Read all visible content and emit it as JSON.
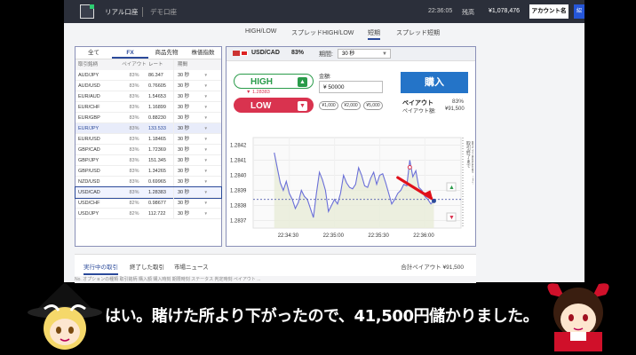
{
  "topbar": {
    "tab_real": "リアル口座",
    "tab_demo": "デモ口座",
    "time": "22:36:05",
    "balance_label": "残高",
    "balance": "¥1,078,476",
    "account_button": "アカウント名",
    "corner_label": "紹"
  },
  "modes": [
    "HIGH/LOW",
    "スプレッドHIGH/LOW",
    "短期",
    "スプレッド短期"
  ],
  "active_mode": "短期",
  "left": {
    "tabs": [
      "全て",
      "FX",
      "商品先物",
      "株価指数"
    ],
    "active_tab": "FX",
    "headers": [
      "取引銘柄",
      "ペイアウト",
      "レート",
      "期間"
    ],
    "rows": [
      {
        "pair": "AUD/JPY",
        "payout": "83%",
        "rate": "86.347",
        "period": "30 秒"
      },
      {
        "pair": "AUD/USD",
        "payout": "83%",
        "rate": "0.76605",
        "period": "30 秒"
      },
      {
        "pair": "EUR/AUD",
        "payout": "83%",
        "rate": "1.54653",
        "period": "30 秒"
      },
      {
        "pair": "EUR/CHF",
        "payout": "83%",
        "rate": "1.16899",
        "period": "30 秒"
      },
      {
        "pair": "EUR/GBP",
        "payout": "83%",
        "rate": "0.88230",
        "period": "30 秒"
      },
      {
        "pair": "EUR/JPY",
        "payout": "83%",
        "rate": "133.533",
        "period": "30 秒"
      },
      {
        "pair": "EUR/USD",
        "payout": "83%",
        "rate": "1.18465",
        "period": "30 秒"
      },
      {
        "pair": "GBP/CAD",
        "payout": "83%",
        "rate": "1.72369",
        "period": "30 秒"
      },
      {
        "pair": "GBP/JPY",
        "payout": "83%",
        "rate": "151.345",
        "period": "30 秒"
      },
      {
        "pair": "GBP/USD",
        "payout": "83%",
        "rate": "1.34265",
        "period": "30 秒"
      },
      {
        "pair": "NZD/USD",
        "payout": "83%",
        "rate": "0.69965",
        "period": "30 秒"
      },
      {
        "pair": "USD/CAD",
        "payout": "83%",
        "rate": "1.28383",
        "period": "30 秒"
      },
      {
        "pair": "USD/CHF",
        "payout": "82%",
        "rate": "0.98677",
        "period": "30 秒"
      },
      {
        "pair": "USD/JPY",
        "payout": "82%",
        "rate": "112.722",
        "period": "30 秒"
      }
    ]
  },
  "trade": {
    "pair": "USD/CAD",
    "payout_pct": "83%",
    "period_label": "期間:",
    "period_value": "30 秒",
    "high_label": "HIGH",
    "low_label": "LOW",
    "rate_low": "▼ 1.28383",
    "amount_label": "金額:",
    "amount_value": "¥ 50000",
    "chips": [
      "¥1,000",
      "¥2,000",
      "¥5,000"
    ],
    "buy_label": "購入",
    "payout_label": "ペイアウト",
    "payout_amount_label": "ペイアウト額:",
    "payout_amount": "¥91,500",
    "side_label_1": "取引終了まで",
    "side_label_2": "取引可能期間終了まで"
  },
  "chart_data": {
    "type": "line",
    "y_ticks": [
      "1.2842",
      "1.2841",
      "1.2840",
      "1.2839",
      "1.2838",
      "1.2837"
    ],
    "x_ticks": [
      "22:34:30",
      "22:35:00",
      "22:35:30",
      "22:36:00"
    ],
    "ylim": [
      1.28365,
      1.28425
    ],
    "x": [
      0,
      2,
      4,
      6,
      8,
      10,
      12,
      14,
      16,
      18,
      20,
      22,
      24,
      26,
      28,
      30,
      32,
      34,
      36,
      38,
      40,
      42,
      44,
      46,
      48,
      50,
      52,
      54,
      56,
      58,
      60,
      62,
      64,
      66,
      68,
      70,
      72,
      74,
      76,
      78,
      80,
      82,
      84,
      86,
      88,
      90,
      92,
      94,
      96,
      98,
      100,
      102,
      104,
      106
    ],
    "values": [
      1.28415,
      1.28405,
      1.28395,
      1.2839,
      1.28396,
      1.28388,
      1.28384,
      1.28378,
      1.28382,
      1.2839,
      1.28386,
      1.28384,
      1.28378,
      1.28372,
      1.28388,
      1.28402,
      1.28397,
      1.2839,
      1.28376,
      1.2838,
      1.28384,
      1.28381,
      1.28388,
      1.284,
      1.28395,
      1.28392,
      1.28391,
      1.28394,
      1.28405,
      1.284,
      1.28393,
      1.28392,
      1.28398,
      1.28402,
      1.28394,
      1.284,
      1.28401,
      1.28395,
      1.28388,
      1.28381,
      1.28384,
      1.28388,
      1.2839,
      1.28394,
      1.28393,
      1.2841,
      1.28399,
      1.28403,
      1.28392,
      1.2839,
      1.28386,
      1.28384,
      1.28381,
      1.28383
    ],
    "x_tick_positions": [
      10,
      40,
      70,
      100
    ],
    "xlim": [
      -14,
      124
    ],
    "strike": 1.28384
  },
  "bottom": {
    "tabs": [
      "実行中の取引",
      "終了した取引",
      "市場ニュース"
    ],
    "total": "合計ペイアウト ¥91,500",
    "columns": "No.   オプションの種類   取引銘柄   購入額   購入時刻   期限時刻   ステータス   判定時刻   ペイアウト   ..."
  },
  "caption": "はい。賭けた所より下がったので、41,500円儲かりました。"
}
